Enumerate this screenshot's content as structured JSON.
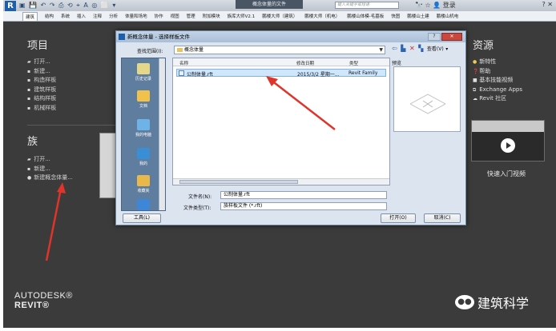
{
  "titlebar": {
    "document_title": "概念体量的文件",
    "search_placeholder": "键入关键字或短语",
    "user_label": "登录",
    "help_label": "?"
  },
  "ribbon_tabs": [
    "建筑",
    "结构",
    "系统",
    "插入",
    "注释",
    "分析",
    "体量和场地",
    "协作",
    "视图",
    "管理",
    "附加模块",
    "族库大师V2.1",
    "鹏楼大师（建筑）",
    "鹏楼大师（机电）",
    "鹏楼山体模-毛墓板",
    "快图",
    "鹏楼山土建",
    "鹏楼山机电"
  ],
  "projects": {
    "heading": "项目",
    "links": [
      "打开...",
      "新建...",
      "构造样板",
      "建筑样板",
      "结构样板",
      "机械样板"
    ]
  },
  "families": {
    "heading": "族",
    "links": [
      "打开...",
      "新建...",
      "新建概念体量..."
    ]
  },
  "resources": {
    "heading": "资源",
    "links": [
      "新特性",
      "帮助",
      "基本技能视频",
      "Exchange Apps",
      "Revit 社区"
    ],
    "video_label": "快速入门视频"
  },
  "brand": {
    "line1": "AUTODESK®",
    "line2": "REVIT®"
  },
  "watermark": "建筑科学",
  "dialog": {
    "title": "新概念体量 - 选择样板文件",
    "look_in_label": "查找范围(I):",
    "look_in_value": "概念体量",
    "views_label": "查看(V)",
    "places": [
      "历史记录",
      "文档",
      "我的电脑",
      "我的",
      "收藏夹"
    ],
    "columns": {
      "name": "名称",
      "date": "修改日期",
      "type": "类型"
    },
    "files": [
      {
        "name": "公制体量.rft",
        "date": "2015/3/2 星期一...",
        "type": "Revit Family"
      }
    ],
    "preview_label": "预览",
    "filename_label": "文件名(N):",
    "filename_value": "公制体量.rft",
    "filetype_label": "文件类型(T):",
    "filetype_value": "族样板文件 (*.rft)",
    "tools_label": "工具(L)",
    "open_label": "打开(O)",
    "cancel_label": "取消(C)"
  },
  "colors": {
    "annotation_arrow": "#e0342a",
    "background": "#3b3b3b",
    "selection": "#cfe6fb"
  }
}
